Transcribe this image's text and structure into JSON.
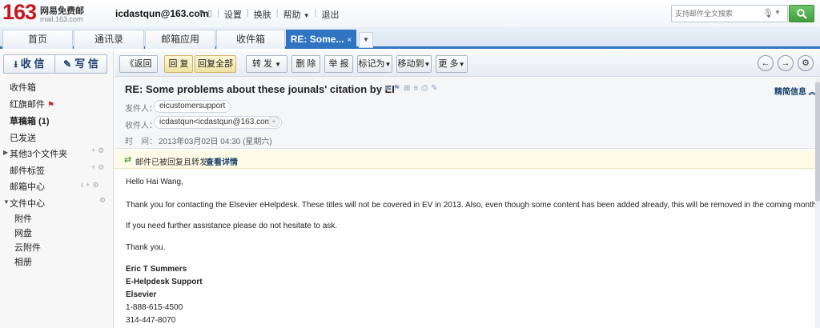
{
  "topbar": {
    "logo_number": "163",
    "logo_title": "网易免费邮",
    "logo_domain": "mail.163.com",
    "account": "icdastqun@163.com",
    "nav": [
      "设置",
      "换肤",
      "帮助",
      "退出"
    ],
    "search_placeholder": "支持邮件全文搜索"
  },
  "tabs": [
    {
      "label": "首页"
    },
    {
      "label": "通讯录"
    },
    {
      "label": "邮箱应用"
    },
    {
      "label": "收件箱"
    },
    {
      "label": "RE: Some...",
      "active": true
    }
  ],
  "sidebar": {
    "receive_label": "收 信",
    "write_label": "写 信",
    "folders": [
      {
        "label": "收件箱"
      },
      {
        "label": "红旗邮件"
      },
      {
        "label": "草稿箱 (1)"
      },
      {
        "label": "已发送"
      },
      {
        "label": "其他3个文件夹"
      },
      {
        "label": "邮件标签"
      },
      {
        "label": "邮箱中心"
      },
      {
        "label": "文件中心"
      }
    ],
    "subfolders": [
      {
        "label": "附件"
      },
      {
        "label": "网盘"
      },
      {
        "label": "云附件"
      },
      {
        "label": "相册"
      }
    ]
  },
  "toolbar": {
    "back": "返回",
    "reply": "回 复",
    "reply_all": "回复全部",
    "forward": "转 发",
    "delete": "删 除",
    "report": "举 报",
    "mark_as": "标记为",
    "move_to": "移动到",
    "more": "更 多"
  },
  "message": {
    "subject": "RE: Some problems about these jounals' citation by EI",
    "detail_link": "精简信息",
    "from_label": "发件人：",
    "from": "eicustomersupport",
    "to_label": "收件人：",
    "to": "icdastqun<icdastqun@163.com>",
    "time_label": "时　间：",
    "date": "2013年03月02日 04:30 (星期六)",
    "notice": "邮件已被回复且转发",
    "notice_link": "查看详情",
    "body": {
      "greeting": "Hello Hai Wang,",
      "para1": "Thank you for contacting the Elsevier eHelpdesk.  These titles will not be covered in EV in 2013.  Also, even though some content has been added already, this will be removed in the coming months.",
      "para2": "If you need further assistance please do not hesitate to ask.",
      "thanks": "Thank you.",
      "sig_name": "Eric T Summers",
      "sig_title": "E-Helpdesk Support",
      "sig_org": "Elsevier",
      "phone1": "1-888-615-4500",
      "phone2": "314-447-8070"
    }
  },
  "colors": {
    "accent": "#2f74c0",
    "logo_red": "#c8161d",
    "notice_bg": "#fdfbe6",
    "search_green": "#4caf46"
  }
}
